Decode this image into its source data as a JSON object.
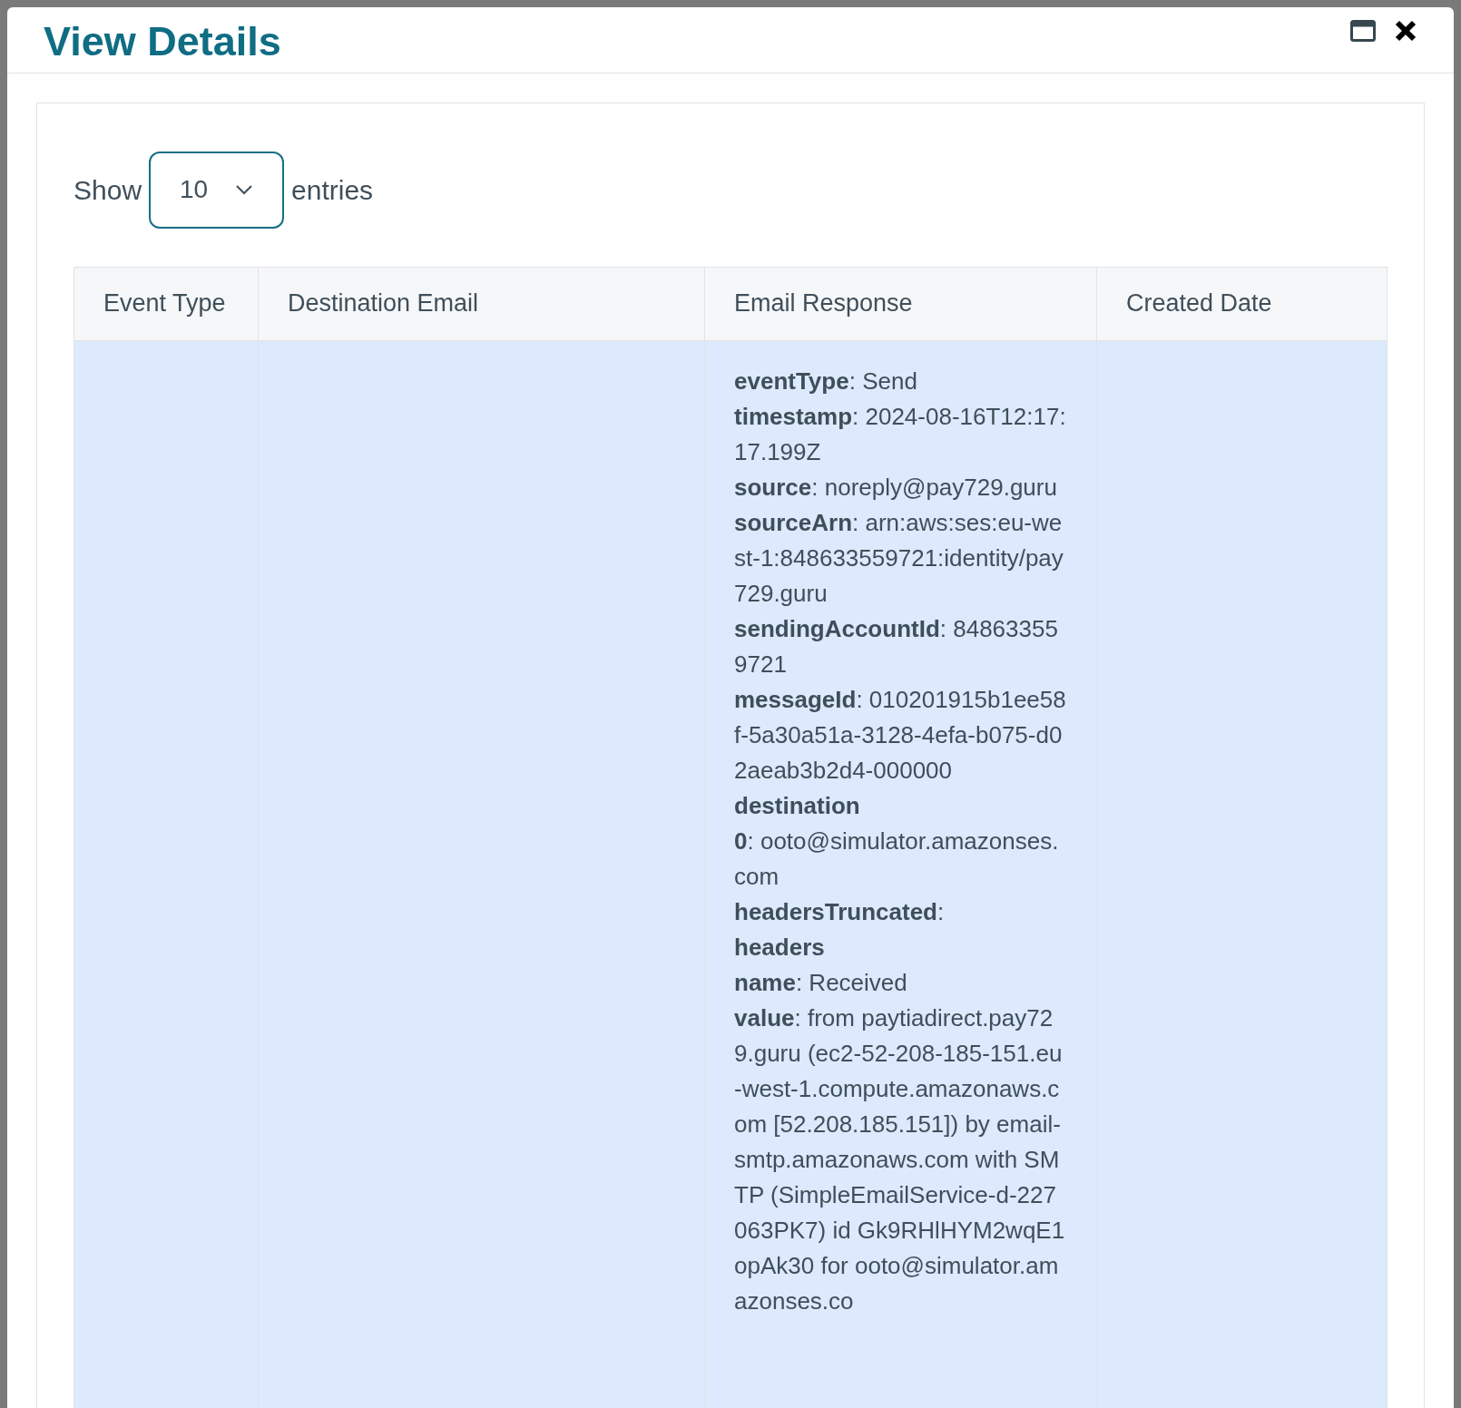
{
  "dialog": {
    "title": "View Details"
  },
  "length_control": {
    "label_before": "Show",
    "value": "10",
    "label_after": "entries"
  },
  "table": {
    "columns": [
      "Event Type",
      "Destination Email",
      "Email Response",
      "Created Date"
    ],
    "rows": [
      {
        "selected": true,
        "email_response": [
          "**eventType**: Send",
          "**timestamp**: 2024-08-16T12:17:17.199Z",
          "**source**: noreply@pay729.guru",
          "**sourceArn**: arn:aws:ses:eu-west-1:848633559721:identity/pay729.guru",
          "**sendingAccountId**: 848633559721",
          "**messageId**: 010201915b1ee58f-5a30a51a-3128-4efa-b075-d02aeab3b2d4-000000",
          "**destination**",
          "**0**: ooto@simulator.amazonses.com",
          "**headersTruncated**:",
          "**headers**",
          "**name**: Received",
          "**value**: from paytiadirect.pay729.guru (ec2-52-208-185-151.eu-west-1.compute.amazonaws.com [52.208.185.151]) by email-smtp.amazonaws.com with SMTP (SimpleEmailService-d-227063PK7) id Gk9RHlHYM2wqE1opAk30 for ooto@simulator.amazonses.co"
        ]
      }
    ]
  }
}
